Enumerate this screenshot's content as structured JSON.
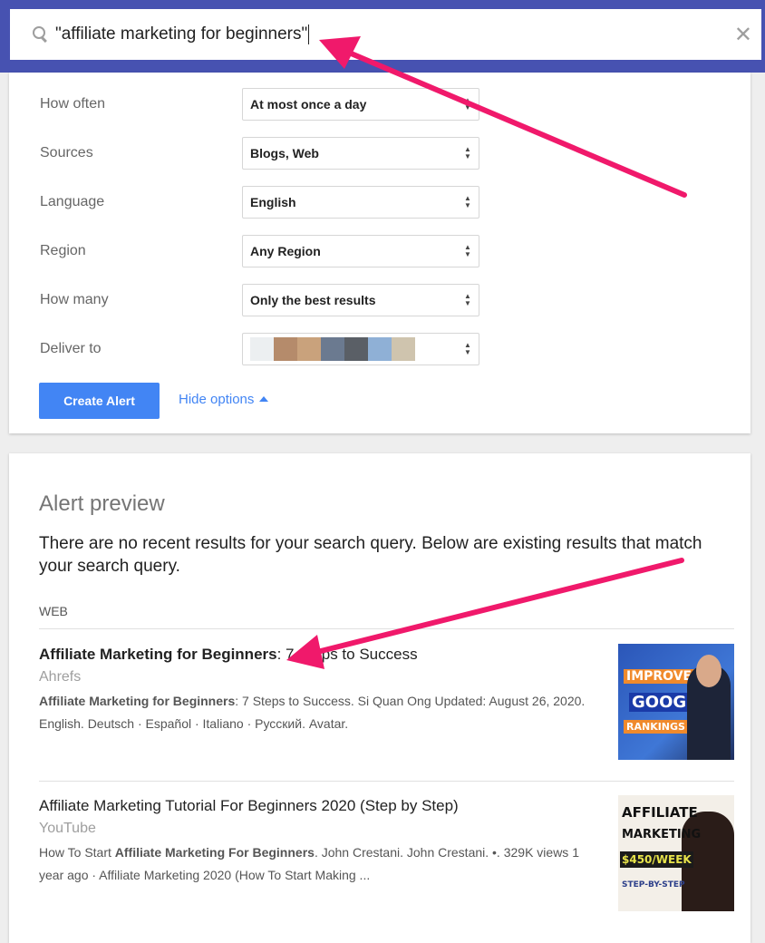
{
  "search": {
    "query": "\"affiliate marketing for beginners\""
  },
  "options": [
    {
      "label": "How often",
      "value": "At most once a day"
    },
    {
      "label": "Sources",
      "value": "Blogs, Web"
    },
    {
      "label": "Language",
      "value": "English"
    },
    {
      "label": "Region",
      "value": "Any Region"
    },
    {
      "label": "How many",
      "value": "Only the best results"
    },
    {
      "label": "Deliver to",
      "value": ""
    }
  ],
  "deliver_swatches": [
    "#eceff1",
    "#b58b6b",
    "#c9a27c",
    "#6b7a90",
    "#5a5f66",
    "#8fb0d6",
    "#cfc4ae"
  ],
  "create_alert": "Create Alert",
  "hide_options": "Hide options",
  "preview": {
    "title": "Alert preview",
    "description": "There are no recent results for your search query. Below are existing results that match your search query.",
    "section": "WEB",
    "results": [
      {
        "title_bold": "Affiliate Marketing for Beginners",
        "title_rest": ": 7 Steps to Success",
        "source": "Ahrefs",
        "desc_bold": "Affiliate Marketing for Beginners",
        "desc_rest": ": 7 Steps to Success. Si Quan Ong Updated: August 26, 2020. English. Deutsch · Español · Italiano · Русский. Avatar.",
        "thumb": [
          "IMPROVE",
          "GOOGLE",
          "RANKINGS"
        ]
      },
      {
        "title_bold": "",
        "title_rest": "Affiliate Marketing Tutorial For Beginners 2020 (Step by Step)",
        "source": "YouTube",
        "desc_pre": "How To Start ",
        "desc_bold": "Affiliate Marketing For Beginners",
        "desc_rest": ". John Crestani. John Crestani. •. 329K views 1 year ago · Affiliate Marketing 2020 (How To Start Making ...",
        "thumb": [
          "AFFILIATE",
          "MARKETING",
          "$450/WEEK",
          "STEP-BY-STEP"
        ]
      }
    ]
  },
  "colors": {
    "topbar": "#4752b1",
    "accent": "#4285f4",
    "arrow": "#f0196b"
  }
}
